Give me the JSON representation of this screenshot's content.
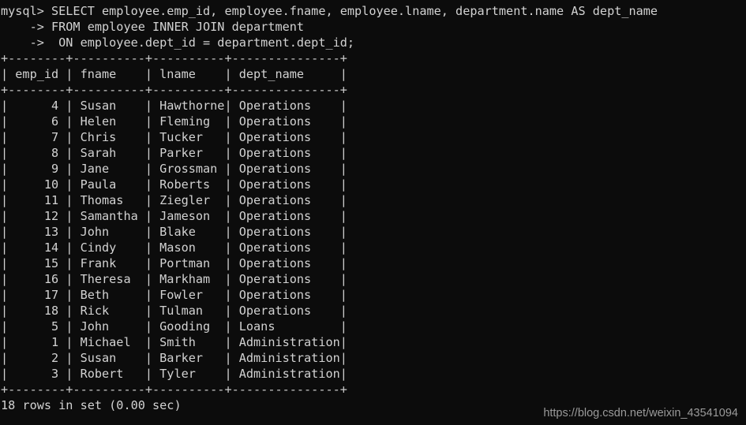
{
  "terminal": {
    "prompt": "mysql>",
    "continuation": "->",
    "query_lines": [
      "mysql> SELECT employee.emp_id, employee.fname, employee.lname, department.name AS dept_name",
      "    -> FROM employee INNER JOIN department",
      "    ->  ON employee.dept_id = department.dept_id;"
    ],
    "query_text": "SELECT employee.emp_id, employee.fname, employee.lname, department.name AS dept_name FROM employee INNER JOIN department ON employee.dept_id = department.dept_id;",
    "status_line": "18 rows in set (0.00 sec)",
    "row_count": 18,
    "elapsed": "0.00 sec",
    "background_color": "#0c0c0c",
    "text_color": "#d2d2d2",
    "rule_color": "#c9c9c9"
  },
  "result_table": {
    "columns": [
      {
        "name": "emp_id",
        "width": 8,
        "align": "right"
      },
      {
        "name": "fname",
        "width": 10,
        "align": "left"
      },
      {
        "name": "lname",
        "width": 10,
        "align": "left"
      },
      {
        "name": "dept_name",
        "width": 15,
        "align": "left"
      }
    ],
    "rows": [
      {
        "emp_id": "4",
        "fname": "Susan",
        "lname": "Hawthorne",
        "dept_name": "Operations"
      },
      {
        "emp_id": "6",
        "fname": "Helen",
        "lname": "Fleming",
        "dept_name": "Operations"
      },
      {
        "emp_id": "7",
        "fname": "Chris",
        "lname": "Tucker",
        "dept_name": "Operations"
      },
      {
        "emp_id": "8",
        "fname": "Sarah",
        "lname": "Parker",
        "dept_name": "Operations"
      },
      {
        "emp_id": "9",
        "fname": "Jane",
        "lname": "Grossman",
        "dept_name": "Operations"
      },
      {
        "emp_id": "10",
        "fname": "Paula",
        "lname": "Roberts",
        "dept_name": "Operations"
      },
      {
        "emp_id": "11",
        "fname": "Thomas",
        "lname": "Ziegler",
        "dept_name": "Operations"
      },
      {
        "emp_id": "12",
        "fname": "Samantha",
        "lname": "Jameson",
        "dept_name": "Operations"
      },
      {
        "emp_id": "13",
        "fname": "John",
        "lname": "Blake",
        "dept_name": "Operations"
      },
      {
        "emp_id": "14",
        "fname": "Cindy",
        "lname": "Mason",
        "dept_name": "Operations"
      },
      {
        "emp_id": "15",
        "fname": "Frank",
        "lname": "Portman",
        "dept_name": "Operations"
      },
      {
        "emp_id": "16",
        "fname": "Theresa",
        "lname": "Markham",
        "dept_name": "Operations"
      },
      {
        "emp_id": "17",
        "fname": "Beth",
        "lname": "Fowler",
        "dept_name": "Operations"
      },
      {
        "emp_id": "18",
        "fname": "Rick",
        "lname": "Tulman",
        "dept_name": "Operations"
      },
      {
        "emp_id": "5",
        "fname": "John",
        "lname": "Gooding",
        "dept_name": "Loans"
      },
      {
        "emp_id": "1",
        "fname": "Michael",
        "lname": "Smith",
        "dept_name": "Administration"
      },
      {
        "emp_id": "2",
        "fname": "Susan",
        "lname": "Barker",
        "dept_name": "Administration"
      },
      {
        "emp_id": "3",
        "fname": "Robert",
        "lname": "Tyler",
        "dept_name": "Administration"
      }
    ]
  },
  "watermark": {
    "text": "https://blog.csdn.net/weixin_43541094",
    "color": "#9a9a9a"
  }
}
